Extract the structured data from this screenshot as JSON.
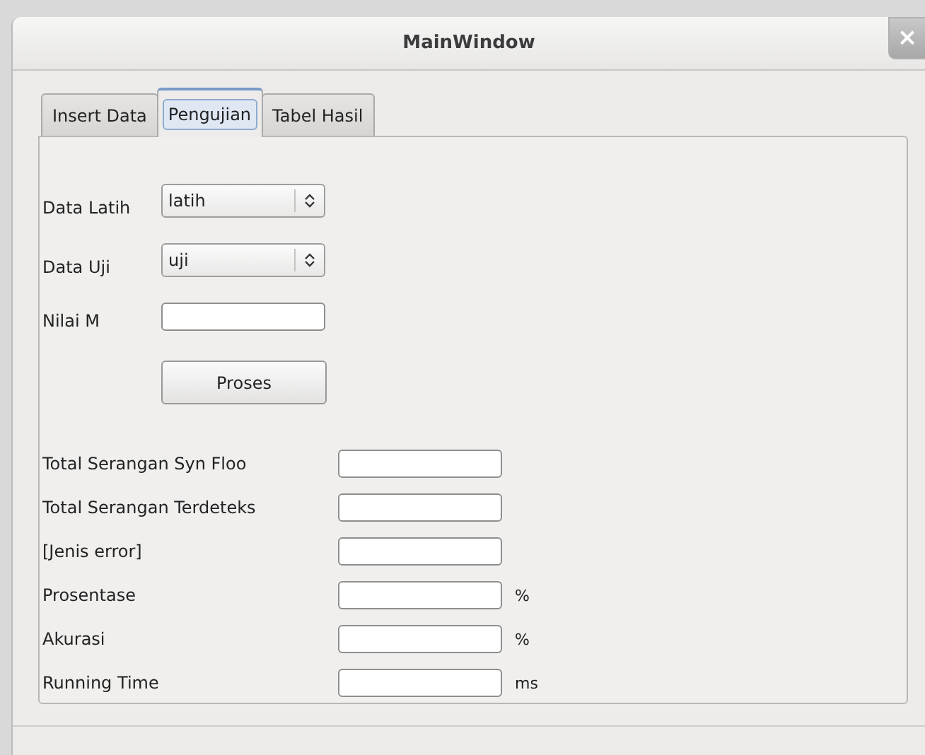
{
  "window": {
    "title": "MainWindow",
    "close": "×"
  },
  "tabs": [
    {
      "label": "Insert Data",
      "selected": false
    },
    {
      "label": "Pengujian",
      "selected": true
    },
    {
      "label": "Tabel Hasil",
      "selected": false
    }
  ],
  "inputs": [
    {
      "kind": "combo",
      "label": "Data Latih",
      "value": "latih"
    },
    {
      "kind": "combo",
      "label": "Data Uji",
      "value": "uji"
    },
    {
      "kind": "text",
      "label": "Nilai M"
    }
  ],
  "button": "Proses",
  "results": [
    {
      "label": "Total Serangan Syn Floo"
    },
    {
      "label": "Total Serangan Terdeteks"
    },
    {
      "label": "[Jenis error]"
    },
    {
      "label": "Prosentase",
      "unit": "%"
    },
    {
      "label": "Akurasi",
      "unit": "%"
    },
    {
      "label": "Running Time",
      "unit": "ms"
    }
  ]
}
